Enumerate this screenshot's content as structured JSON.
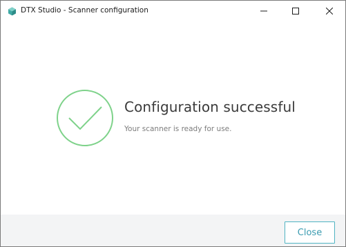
{
  "window": {
    "title": "DTX Studio - Scanner configuration",
    "controls": {
      "minimize_icon": "minimize-icon",
      "maximize_icon": "maximize-icon",
      "close_icon": "close-icon"
    }
  },
  "main": {
    "status_icon": "checkmark-circle-icon",
    "heading": "Configuration successful",
    "message": "Your scanner is ready for use."
  },
  "footer": {
    "close_label": "Close"
  },
  "colors": {
    "success": "#7ed28a",
    "accent": "#4fb3c2",
    "footer_bg": "#f3f4f5"
  }
}
